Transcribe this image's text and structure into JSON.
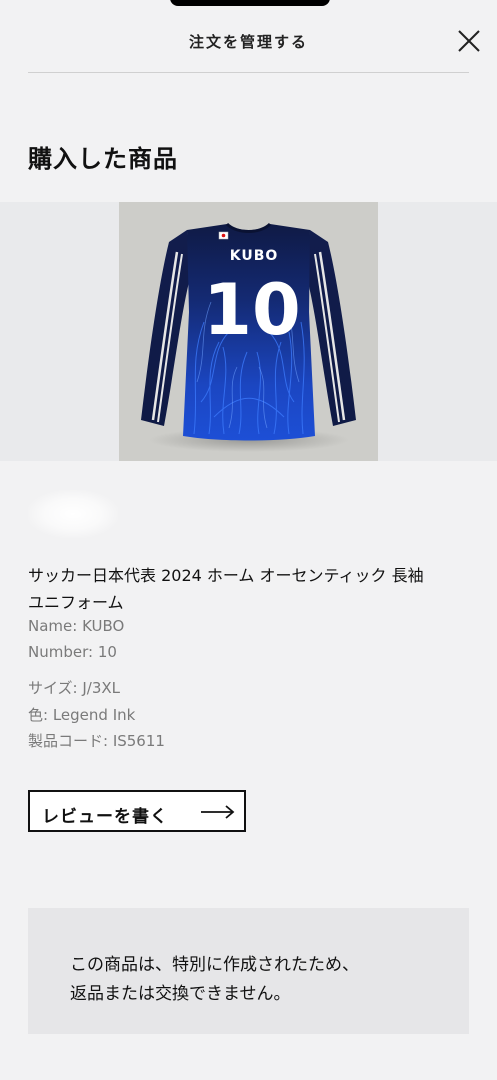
{
  "header": {
    "title": "注文を管理する",
    "close_icon": "close-icon"
  },
  "section": {
    "title": "購入した商品"
  },
  "product": {
    "image_icon": "jersey-image",
    "jersey_name": "KUBO",
    "jersey_number": "10",
    "name_line1": "サッカー日本代表 2024 ホーム オーセンティック 長袖",
    "name_line2": "ユニフォーム",
    "custom_name": "Name: KUBO",
    "custom_number": "Number: 10",
    "size": "サイズ: J/3XL",
    "color": "色: Legend Ink",
    "code": "製品コード: IS5611"
  },
  "actions": {
    "review_label": "レビューを書く",
    "arrow_icon": "arrow-right-icon"
  },
  "notice": {
    "line1": "この商品は、特別に作成されたため、",
    "line2": "返品または交換できません。"
  },
  "colors": {
    "background": "#f2f2f3",
    "notice_bg": "#e6e6e8",
    "jersey_navy": "#0f1a45",
    "jersey_blue": "#1d49c8"
  }
}
